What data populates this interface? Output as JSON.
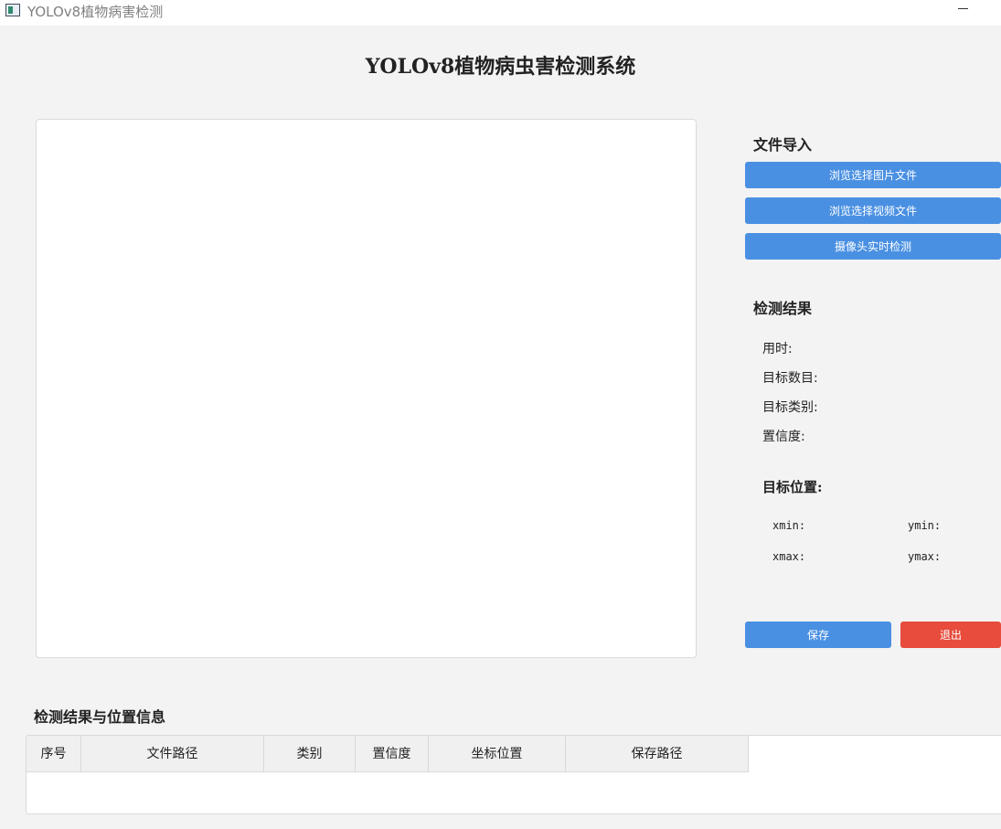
{
  "window": {
    "title": "YOLOv8植物病害检测"
  },
  "header": {
    "title": "YOLOv8植物病虫害检测系统"
  },
  "file_import": {
    "heading": "文件导入",
    "browse_image_label": "浏览选择图片文件",
    "browse_video_label": "浏览选择视频文件",
    "camera_label": "摄像头实时检测"
  },
  "results": {
    "heading": "检测结果",
    "time_label": "用时:",
    "count_label": "目标数目:",
    "class_label": "目标类别:",
    "confidence_label": "置信度:"
  },
  "position": {
    "heading": "目标位置:",
    "xmin_label": "xmin:",
    "ymin_label": "ymin:",
    "xmax_label": "xmax:",
    "ymax_label": "ymax:"
  },
  "actions": {
    "save_label": "保存",
    "exit_label": "退出"
  },
  "table": {
    "heading": "检测结果与位置信息",
    "columns": [
      "序号",
      "文件路径",
      "类别",
      "置信度",
      "坐标位置",
      "保存路径"
    ],
    "rows": []
  },
  "colors": {
    "primary_button": "#4a90e2",
    "exit_button": "#e74c3c",
    "background": "#f3f3f3"
  }
}
